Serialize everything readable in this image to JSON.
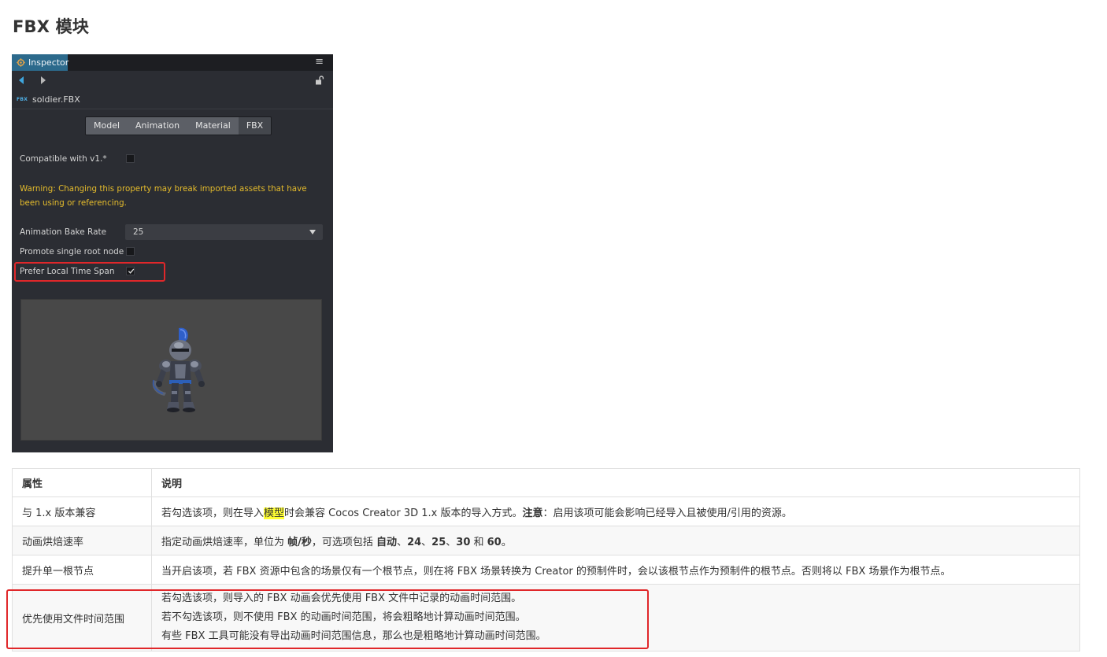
{
  "page": {
    "title": "FBX 模块"
  },
  "inspector": {
    "tab_label": "Inspector",
    "file_badge": "FBX",
    "file_name": "soldier.FBX",
    "tabs": [
      "Model",
      "Animation",
      "Material",
      "FBX"
    ],
    "active_tab": "FBX",
    "compat_label": "Compatible with v1.*",
    "compat_checked": false,
    "warning_text": "Warning: Changing this property may break imported assets that have been using or referencing.",
    "bake_rate_label": "Animation Bake Rate",
    "bake_rate_value": "25",
    "promote_label": "Promote single root node",
    "promote_checked": false,
    "prefer_label": "Prefer Local Time Span",
    "prefer_checked": true,
    "colors": {
      "panel_bg": "#2b2d33",
      "tab_active": "#2c6a8c",
      "warning": "#e3ba2c",
      "highlight_box": "#e0272a"
    }
  },
  "table": {
    "headers": [
      "属性",
      "说明"
    ],
    "rows": [
      {
        "name": "与 1.x 版本兼容",
        "desc_pre": "若勾选该项，则在导入",
        "desc_highlight": "模型",
        "desc_mid": "时会兼容 Cocos Creator 3D 1.x 版本的导入方式。",
        "desc_note_label": "注意",
        "desc_post": "：启用该项可能会影响已经导入且被使用/引用的资源。"
      },
      {
        "name": "动画烘焙速率",
        "desc_pre": "指定动画烘焙速率，单位为 ",
        "desc_unit": "帧/秒",
        "desc_mid": "，可选项包括 ",
        "desc_opt_auto": "自动",
        "desc_sep1": "、",
        "desc_opt_24": "24",
        "desc_sep2": "、",
        "desc_opt_25": "25",
        "desc_sep3": "、",
        "desc_opt_30": "30",
        "desc_and": " 和 ",
        "desc_opt_60": "60",
        "desc_end": "。"
      },
      {
        "name": "提升单一根节点",
        "desc": "当开启该项，若 FBX 资源中包含的场景仅有一个根节点，则在将 FBX 场景转换为 Creator 的预制件时，会以该根节点作为预制件的根节点。否则将以 FBX 场景作为根节点。"
      },
      {
        "name": "优先使用文件时间范围",
        "desc_lines": [
          "若勾选该项，则导入的 FBX 动画会优先使用 FBX 文件中记录的动画时间范围。",
          "若不勾选该项，则不使用 FBX 的动画时间范围，将会粗略地计算动画时间范围。",
          "有些 FBX 工具可能没有导出动画时间范围信息，那么也是粗略地计算动画时间范围。"
        ]
      }
    ]
  }
}
